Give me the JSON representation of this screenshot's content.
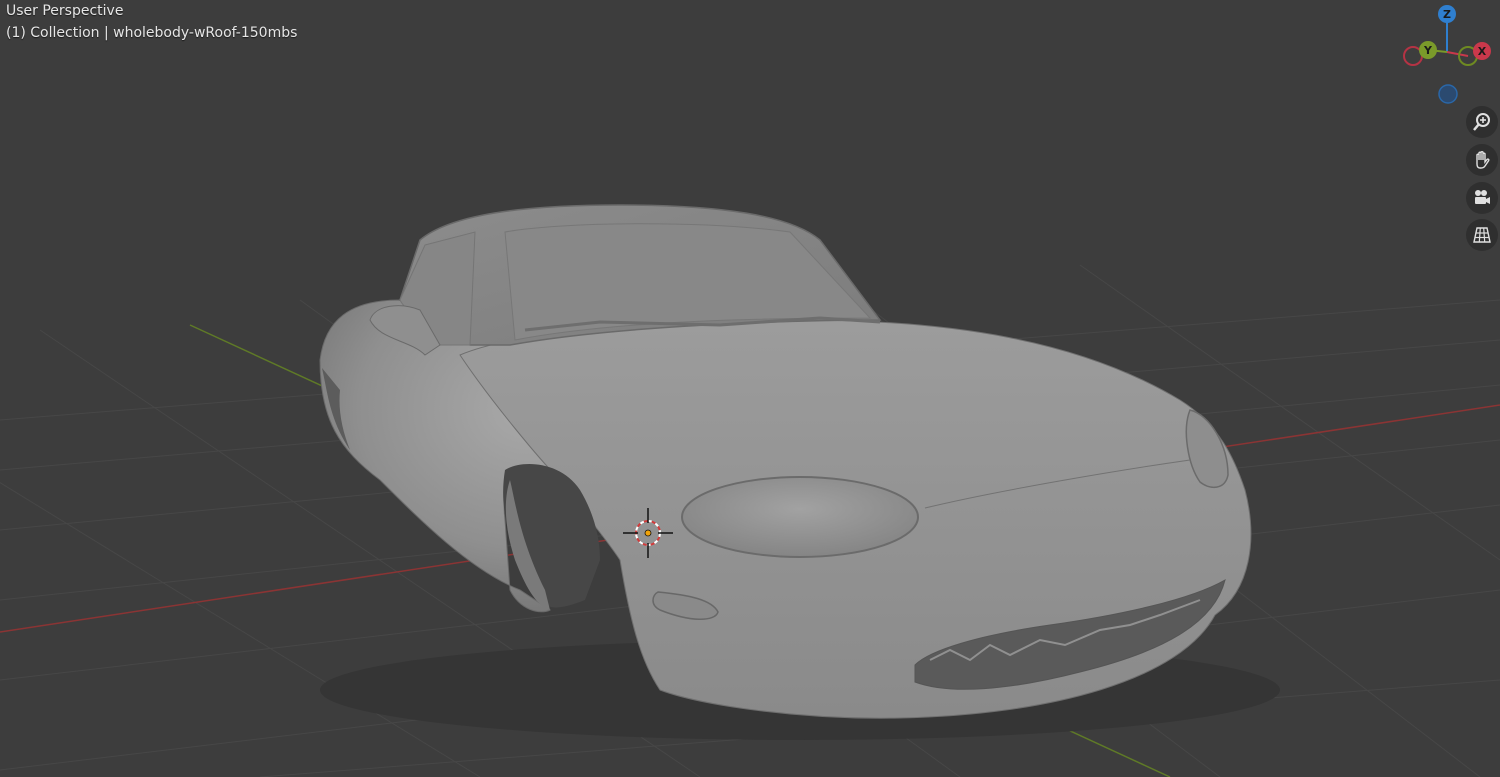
{
  "viewport": {
    "view_title": "User Perspective",
    "collection_line": "(1) Collection | wholebody-wRoof-150mbs",
    "background_color": "#3d3d3d"
  },
  "gizmo": {
    "z_label": "Z",
    "y_label": "Y",
    "x_label": "X",
    "colors": {
      "x": "#c9384b",
      "y": "#7a9a2a",
      "z": "#2f7fcf"
    }
  },
  "navigation": {
    "buttons": [
      "zoom-icon",
      "pan-hand-icon",
      "camera-icon",
      "perspective-grid-icon"
    ]
  },
  "scene": {
    "object_name": "wholebody-wRoof-150mbs",
    "object_type": "mesh car body",
    "x_axis_color": "#a33a3a",
    "y_axis_color": "#6d8a2b"
  }
}
